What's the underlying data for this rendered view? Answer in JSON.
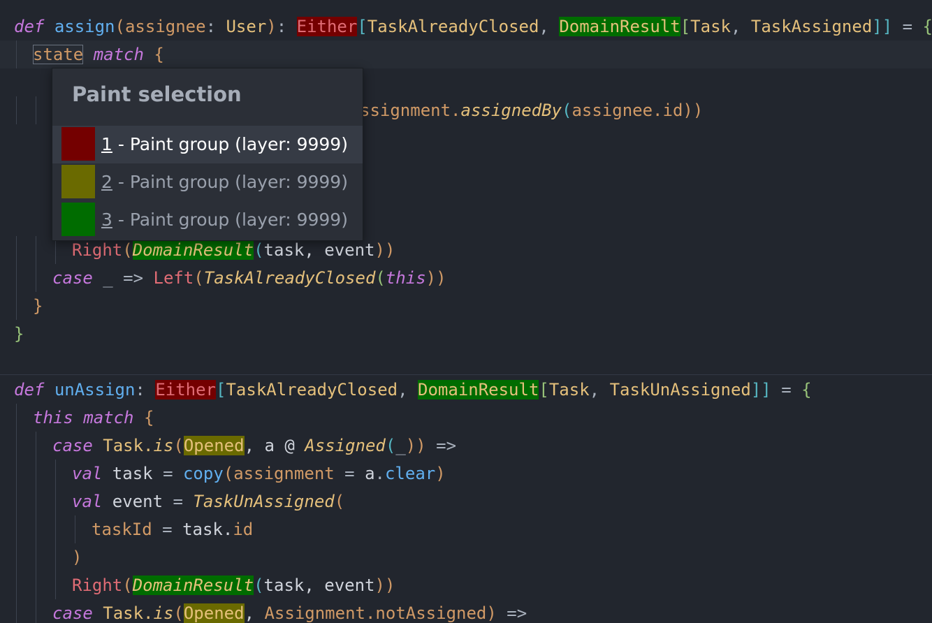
{
  "colors": {
    "background": "#22262e",
    "paint_red": "#740000",
    "paint_olive": "#6a6a00",
    "paint_green": "#006c00"
  },
  "popup": {
    "title": "Paint selection",
    "items": [
      {
        "mnemonic": "1",
        "label": " - Paint group (layer: 9999)",
        "color": "#740000",
        "selected": true
      },
      {
        "mnemonic": "2",
        "label": " - Paint group (layer: 9999)",
        "color": "#6a6a00",
        "selected": false
      },
      {
        "mnemonic": "3",
        "label": " - Paint group (layer: 9999)",
        "color": "#006c00",
        "selected": false
      }
    ]
  },
  "code": {
    "l1": {
      "def": "def",
      "name": "assign",
      "paren_open": "(",
      "param": "assignee",
      "colon": ": ",
      "ptype": "User",
      "paren_close": ")",
      "colon2": ": ",
      "either": "Either",
      "lb": "[",
      "t1": "TaskAlreadyClosed",
      "comma": ", ",
      "dr": "DomainResult",
      "lb2": "[",
      "t2": "Task",
      "comma2": ", ",
      "t3": "TaskAssigned",
      "rb": "]]",
      "eq": " = ",
      "brace": "{"
    },
    "l2": {
      "state": "state",
      "match": "match",
      "brace": "{"
    },
    "l3": {
      "text": "ssignment.",
      "method": "assignedBy",
      "po": "(",
      "arg": "assignee.id",
      "pc": "))"
    },
    "l4": {
      "right": "Right",
      "po": "(",
      "dr": "DomainResult",
      "po2": "(",
      "args": "task, event",
      "pc": "))"
    },
    "l5": {
      "case": "case",
      "rest": " _ => ",
      "left": "Left",
      "po": "(",
      "closed": "TaskAlreadyClosed",
      "po2": "(",
      "this": "this",
      "pc": "))"
    },
    "l6": {
      "brace": "}"
    },
    "l7": {
      "brace": "}"
    },
    "l8": {
      "def": "def",
      "name": "unAssign",
      "colon": ": ",
      "either": "Either",
      "lb": "[",
      "t1": "TaskAlreadyClosed",
      "comma": ", ",
      "dr": "DomainResult",
      "lb2": "[",
      "t2": "Task",
      "comma2": ", ",
      "t3": "TaskUnAssigned",
      "rb": "]]",
      "eq": " = ",
      "brace": "{"
    },
    "l9": {
      "this": "this",
      "match": "match",
      "brace": "{"
    },
    "l10": {
      "case": "case",
      "task": "Task.",
      "is": "is",
      "po": "(",
      "opened": "Opened",
      "mid": ", a @ ",
      "assigned": "Assigned",
      "po2": "(",
      "us": "_",
      "pc": "))",
      "arrow": " =>"
    },
    "l11": {
      "val": "val",
      "name": " task ",
      "eq": "= ",
      "copy": "copy",
      "po": "(",
      "field": "assignment",
      "eq2": " = ",
      "obj": "a",
      "dot": ".",
      "clear": "clear",
      "pc": ")"
    },
    "l12": {
      "val": "val",
      "name": " event ",
      "eq": "= ",
      "ctor": "TaskUnAssigned",
      "po": "("
    },
    "l13": {
      "field": "taskId",
      "eq": " = ",
      "val": "task.",
      "id": "id"
    },
    "l14": {
      "pc": ")"
    },
    "l15": {
      "right": "Right",
      "po": "(",
      "dr": "DomainResult",
      "po2": "(",
      "args": "task, event",
      "pc": "))"
    },
    "l16": {
      "case": "case",
      "task": "Task.",
      "is": "is",
      "po": "(",
      "opened": "Opened",
      "comma": ", ",
      "assign": "Assignment.",
      "na": "notAssigned",
      "pc": ")",
      "arrow": " =>"
    }
  }
}
